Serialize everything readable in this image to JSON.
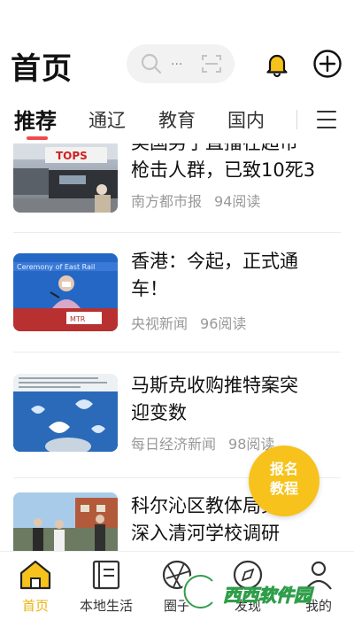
{
  "header": {
    "title": "首页",
    "search_hint": "...",
    "notification_icon": "bell-icon",
    "add_icon": "plus-icon"
  },
  "tabs": [
    {
      "label": "推荐",
      "active": true
    },
    {
      "label": "通辽",
      "active": false
    },
    {
      "label": "教育",
      "active": false
    },
    {
      "label": "国内",
      "active": false
    }
  ],
  "tabs_menu_icon": "menu-icon",
  "accent_color": "#f04b4b",
  "brand_yellow": "#f6c21b",
  "articles": [
    {
      "title_line1": "美国男子直播在超市",
      "title_line2": "枪击人群，已致10死3",
      "source": "南方都市报",
      "reads": "94阅读"
    },
    {
      "title_line1": "香港：今起，正式通",
      "title_line2": "车！",
      "source": "央视新闻",
      "reads": "96阅读"
    },
    {
      "title_line1": "马斯克收购推特案突",
      "title_line2": "迎变数",
      "source": "每日经济新闻",
      "reads": "98阅读"
    },
    {
      "title_line1": "科尔沁区教体局党组",
      "title_line2": "深入清河学校调研",
      "source": "",
      "reads": ""
    }
  ],
  "fab": {
    "line1": "报名",
    "line2": "教程"
  },
  "bottom_nav": [
    {
      "label": "首页",
      "icon": "home-icon",
      "active": true
    },
    {
      "label": "本地生活",
      "icon": "book-icon",
      "active": false
    },
    {
      "label": "圈子",
      "icon": "aperture-icon",
      "active": false
    },
    {
      "label": "发现",
      "icon": "compass-icon",
      "active": false
    },
    {
      "label": "我的",
      "icon": "user-icon",
      "active": false
    }
  ],
  "watermark": {
    "text": "西西软件园"
  }
}
